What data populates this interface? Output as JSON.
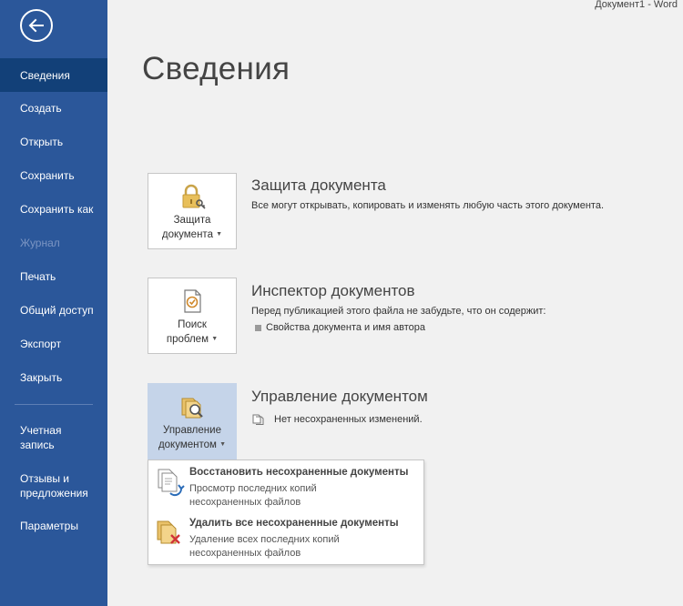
{
  "window": {
    "title": "Документ1  -  Word"
  },
  "page": {
    "title": "Сведения"
  },
  "sidebar": {
    "items": [
      {
        "label": "Сведения"
      },
      {
        "label": "Создать"
      },
      {
        "label": "Открыть"
      },
      {
        "label": "Сохранить"
      },
      {
        "label": "Сохранить как"
      },
      {
        "label": "Журнал"
      },
      {
        "label": "Печать"
      },
      {
        "label": "Общий доступ"
      },
      {
        "label": "Экспорт"
      },
      {
        "label": "Закрыть"
      },
      {
        "label_line1": "Учетная",
        "label_line2": "запись"
      },
      {
        "label_line1": "Отзывы и",
        "label_line2": "предложения"
      },
      {
        "label": "Параметры"
      }
    ]
  },
  "protect": {
    "tile_line1": "Защита",
    "tile_line2": "документа",
    "title": "Защита документа",
    "desc": "Все могут открывать, копировать и изменять любую часть этого документа."
  },
  "inspect": {
    "tile_line1": "Поиск",
    "tile_line2": "проблем",
    "title": "Инспектор документов",
    "desc": "Перед публикацией этого файла не забудьте, что он содержит:",
    "bullet": "Свойства документа и имя автора"
  },
  "manage": {
    "tile_line1": "Управление",
    "tile_line2": "документом",
    "title": "Управление документом",
    "status": "Нет несохраненных изменений."
  },
  "menu": {
    "items": [
      {
        "title": "Восстановить несохраненные документы",
        "desc_line1": "Просмотр последних копий",
        "desc_line2": "несохраненных файлов"
      },
      {
        "title": "Удалить все несохраненные документы",
        "desc_line1": "Удаление всех последних копий",
        "desc_line2": "несохраненных файлов"
      }
    ]
  },
  "colors": {
    "sidebar": "#2b579a",
    "sidebar_active": "#124078",
    "highlight": "#c5d4e9"
  }
}
